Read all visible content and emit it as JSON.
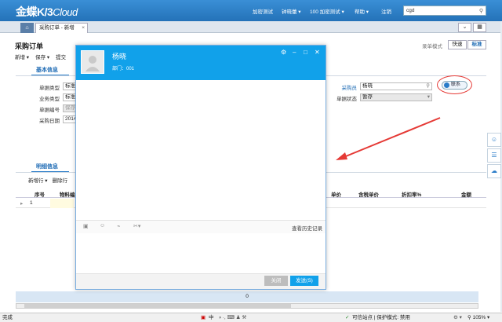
{
  "app": {
    "brand_main": "金蝶K/3",
    "brand_sub": "Cloud"
  },
  "topnav": {
    "items": [
      "加密测试",
      "钟晓蕾",
      "100 加密测试",
      "帮助",
      "注销"
    ],
    "search_value": "cgd"
  },
  "tabs": {
    "doc_tab": "采购订单 - 新增"
  },
  "page": {
    "title": "采购订单",
    "toolbar": [
      "新增 ▾",
      "保存 ▾",
      "提交"
    ],
    "mode_label": "录单模式",
    "mode_fast": "快速",
    "mode_standard": "标准"
  },
  "basic": {
    "section": "基本信息",
    "fields": [
      {
        "label": "单据类型",
        "value": "标准"
      },
      {
        "label": "业务类型",
        "value": "标准"
      },
      {
        "label": "单据编号",
        "value": "保存"
      },
      {
        "label": "采购日期",
        "value": "2014"
      }
    ],
    "buyer_label": "采购员",
    "buyer_value": "杨晓",
    "status_label": "单据状态",
    "status_value": "暂存",
    "contact_button": "联系"
  },
  "detail": {
    "section": "明细信息",
    "toolbar": [
      "新增行 ▾",
      "删除行"
    ],
    "columns": [
      "序号",
      "物料编",
      "单价",
      "含税单价",
      "折扣率%",
      "金额"
    ],
    "row_index": "1",
    "total": "0"
  },
  "chat": {
    "name": "杨晓",
    "dept": "部门：001",
    "history_link": "查看历史记录",
    "close_button": "关闭",
    "send_button": "发送(S)"
  },
  "status": {
    "left": "完成",
    "ime": "中",
    "zone": "可信站点 | 保护模式: 禁用",
    "zoom": "105%"
  },
  "colors": {
    "header": "#2472b8",
    "chat_header": "#11a1ea",
    "annotation": "#e53935"
  }
}
